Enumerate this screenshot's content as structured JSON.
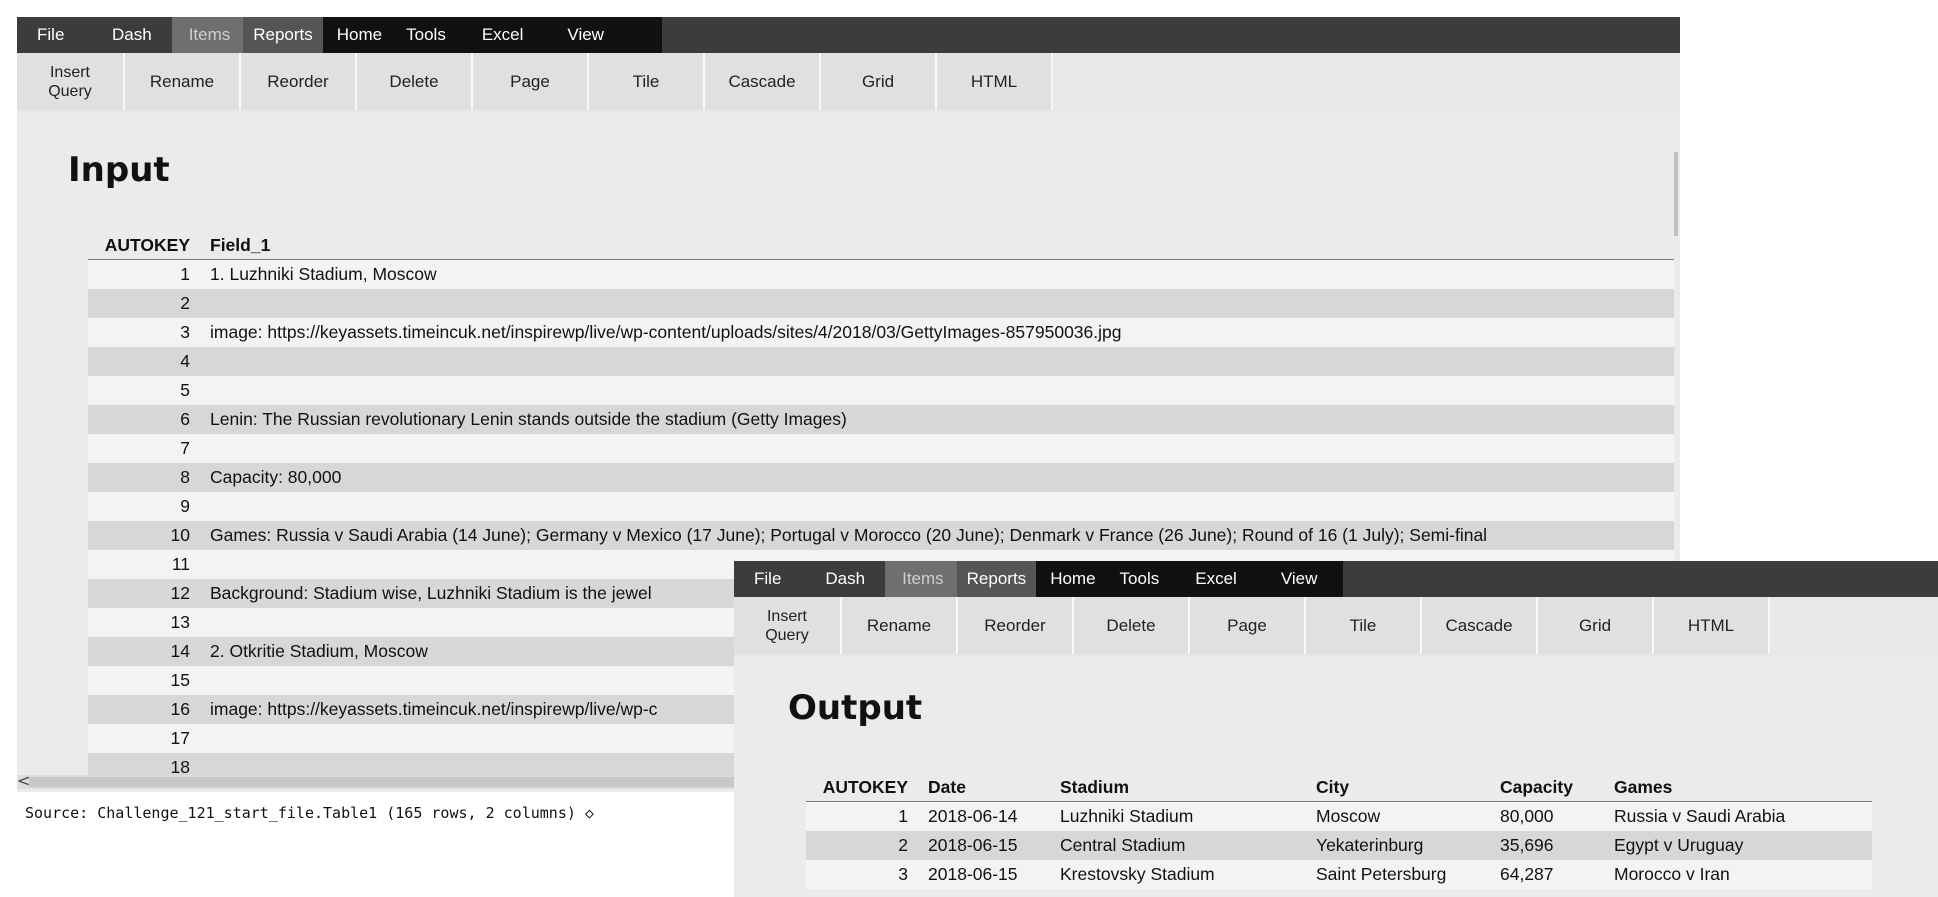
{
  "menu_labels": [
    "File",
    "Dash",
    "Items",
    "Reports",
    "Home",
    "Tools",
    "Excel",
    "View"
  ],
  "toolbar_labels": [
    "Insert Query",
    "Rename",
    "Reorder",
    "Delete",
    "Page",
    "Tile",
    "Cascade",
    "Grid",
    "HTML"
  ],
  "input_window": {
    "title": "Input",
    "columns": [
      "AUTOKEY",
      "Field_1"
    ],
    "rows": [
      [
        "1",
        "1. Luzhniki Stadium, Moscow"
      ],
      [
        "2",
        ""
      ],
      [
        "3",
        "image: https://keyassets.timeincuk.net/inspirewp/live/wp-content/uploads/sites/4/2018/03/GettyImages-857950036.jpg"
      ],
      [
        "4",
        ""
      ],
      [
        "5",
        ""
      ],
      [
        "6",
        "Lenin: The Russian revolutionary Lenin stands outside the stadium (Getty Images)"
      ],
      [
        "7",
        ""
      ],
      [
        "8",
        "Capacity: 80,000"
      ],
      [
        "9",
        ""
      ],
      [
        "10",
        "Games: Russia v Saudi Arabia (14 June); Germany v Mexico (17 June); Portugal v Morocco (20 June); Denmark v France (26 June); Round of 16 (1 July); Semi-final"
      ],
      [
        "11",
        ""
      ],
      [
        "12",
        "Background: Stadium wise, Luzhniki Stadium is the jewel"
      ],
      [
        "13",
        ""
      ],
      [
        "14",
        "2. Otkritie Stadium, Moscow"
      ],
      [
        "15",
        ""
      ],
      [
        "16",
        "image: https://keyassets.timeincuk.net/inspirewp/live/wp-c"
      ],
      [
        "17",
        ""
      ],
      [
        "18",
        ""
      ]
    ],
    "scroll_left_arrow": "<",
    "source_text": "Source: Challenge_121_start_file.Table1 (165 rows, 2 columns) ◇"
  },
  "output_window": {
    "title": "Output",
    "columns": [
      "AUTOKEY",
      "Date",
      "Stadium",
      "City",
      "Capacity",
      "Games"
    ],
    "rows": [
      [
        "1",
        "2018-06-14",
        "Luzhniki Stadium",
        "Moscow",
        "80,000",
        "Russia v Saudi Arabia"
      ],
      [
        "2",
        "2018-06-15",
        "Central Stadium",
        "Yekaterinburg",
        "35,696",
        "Egypt v Uruguay"
      ],
      [
        "3",
        "2018-06-15",
        "Krestovsky Stadium",
        "Saint Petersburg",
        "64,287",
        "Morocco v Iran"
      ]
    ]
  }
}
